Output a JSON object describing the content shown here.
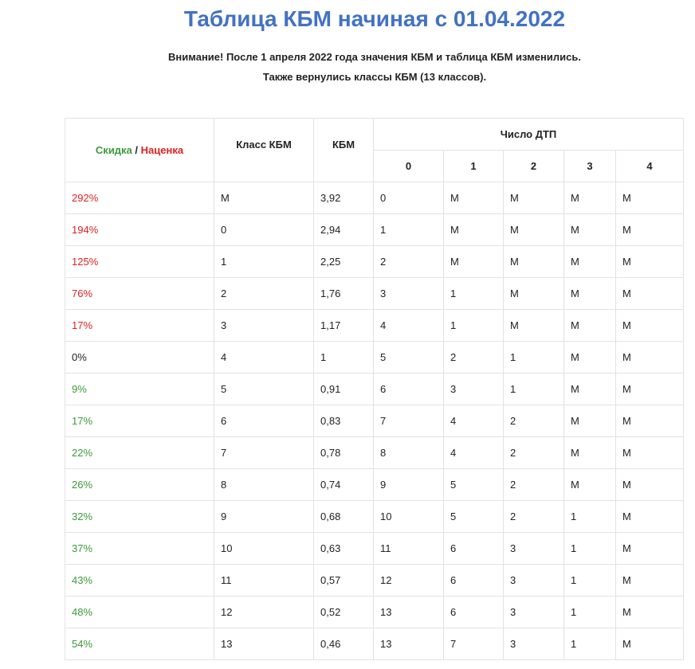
{
  "title": "Таблица КБМ начиная с 01.04.2022",
  "notice": {
    "line1": "Внимание! После 1 апреля 2022 года значения КБМ и таблица КБМ изменились.",
    "line2": "Также вернулись классы КБМ (13 классов)."
  },
  "colors": {
    "title": "#4272c4",
    "surcharge": "#e02020",
    "discount": "#3b9b3b"
  },
  "table": {
    "header": {
      "discount": "Скидка",
      "separator": " / ",
      "surcharge": "Наценка",
      "class": "Класс КБМ",
      "kbm": "КБМ",
      "accidents": "Число ДТП",
      "accident_counts": [
        "0",
        "1",
        "2",
        "3",
        "4"
      ]
    },
    "rows": [
      {
        "pct": "292%",
        "tone": "red",
        "cls": "М",
        "kbm": "3,92",
        "a": [
          "0",
          "М",
          "М",
          "М",
          "М"
        ]
      },
      {
        "pct": "194%",
        "tone": "red",
        "cls": "0",
        "kbm": "2,94",
        "a": [
          "1",
          "М",
          "М",
          "М",
          "М"
        ]
      },
      {
        "pct": "125%",
        "tone": "red",
        "cls": "1",
        "kbm": "2,25",
        "a": [
          "2",
          "М",
          "М",
          "М",
          "М"
        ]
      },
      {
        "pct": "76%",
        "tone": "red",
        "cls": "2",
        "kbm": "1,76",
        "a": [
          "3",
          "1",
          "М",
          "М",
          "М"
        ]
      },
      {
        "pct": "17%",
        "tone": "red",
        "cls": "3",
        "kbm": "1,17",
        "a": [
          "4",
          "1",
          "М",
          "М",
          "М"
        ]
      },
      {
        "pct": "0%",
        "tone": "neutral",
        "cls": "4",
        "kbm": "1",
        "a": [
          "5",
          "2",
          "1",
          "М",
          "М"
        ]
      },
      {
        "pct": "9%",
        "tone": "green",
        "cls": "5",
        "kbm": "0,91",
        "a": [
          "6",
          "3",
          "1",
          "М",
          "М"
        ]
      },
      {
        "pct": "17%",
        "tone": "green",
        "cls": "6",
        "kbm": "0,83",
        "a": [
          "7",
          "4",
          "2",
          "М",
          "М"
        ]
      },
      {
        "pct": "22%",
        "tone": "green",
        "cls": "7",
        "kbm": "0,78",
        "a": [
          "8",
          "4",
          "2",
          "М",
          "М"
        ]
      },
      {
        "pct": "26%",
        "tone": "green",
        "cls": "8",
        "kbm": "0,74",
        "a": [
          "9",
          "5",
          "2",
          "М",
          "М"
        ]
      },
      {
        "pct": "32%",
        "tone": "green",
        "cls": "9",
        "kbm": "0,68",
        "a": [
          "10",
          "5",
          "2",
          "1",
          "М"
        ]
      },
      {
        "pct": "37%",
        "tone": "green",
        "cls": "10",
        "kbm": "0,63",
        "a": [
          "11",
          "6",
          "3",
          "1",
          "М"
        ]
      },
      {
        "pct": "43%",
        "tone": "green",
        "cls": "11",
        "kbm": "0,57",
        "a": [
          "12",
          "6",
          "3",
          "1",
          "М"
        ]
      },
      {
        "pct": "48%",
        "tone": "green",
        "cls": "12",
        "kbm": "0,52",
        "a": [
          "13",
          "6",
          "3",
          "1",
          "М"
        ]
      },
      {
        "pct": "54%",
        "tone": "green",
        "cls": "13",
        "kbm": "0,46",
        "a": [
          "13",
          "7",
          "3",
          "1",
          "М"
        ]
      }
    ]
  }
}
